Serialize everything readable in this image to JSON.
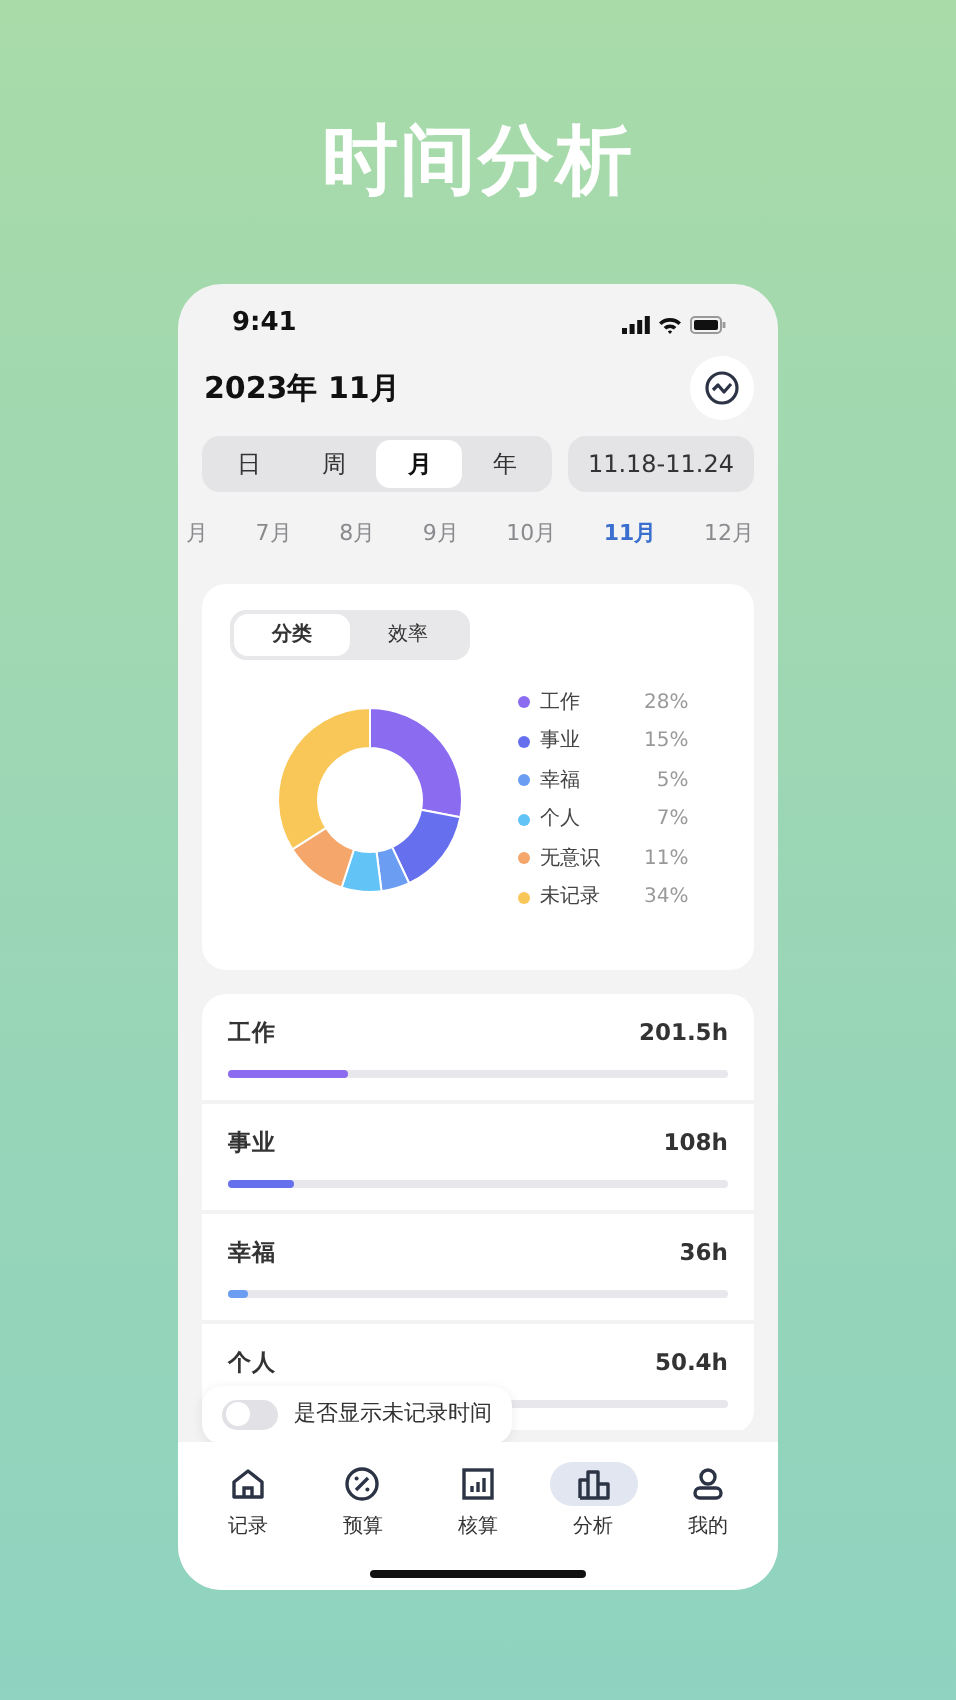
{
  "headline": "时间分析",
  "status_bar": {
    "time": "9:41"
  },
  "header": {
    "title": "2023年 11月"
  },
  "period_tabs": [
    {
      "label": "日",
      "selected": false
    },
    {
      "label": "周",
      "selected": false
    },
    {
      "label": "月",
      "selected": true
    },
    {
      "label": "年",
      "selected": false
    }
  ],
  "date_range": "11.18-11.24",
  "months": [
    {
      "label": "月",
      "selected": false
    },
    {
      "label": "7月",
      "selected": false
    },
    {
      "label": "8月",
      "selected": false
    },
    {
      "label": "9月",
      "selected": false
    },
    {
      "label": "10月",
      "selected": false
    },
    {
      "label": "11月",
      "selected": true
    },
    {
      "label": "12月",
      "selected": false
    }
  ],
  "analysis": {
    "tabs": [
      {
        "label": "分类",
        "selected": true
      },
      {
        "label": "效率",
        "selected": false
      }
    ],
    "chart_data": {
      "type": "donut",
      "categories": [
        "工作",
        "事业",
        "幸福",
        "个人",
        "无意识",
        "未记录"
      ],
      "values": [
        28,
        15,
        5,
        7,
        11,
        34
      ]
    },
    "legend": [
      {
        "percent": "28%",
        "color": "#8b6cf0"
      },
      {
        "percent": "15%",
        "color": "#6670ee"
      },
      {
        "percent": "5%",
        "color": "#6b9df2"
      },
      {
        "percent": "7%",
        "color": "#62c4f6"
      },
      {
        "percent": "11%",
        "color": "#f5a66a"
      },
      {
        "percent": "34%",
        "color": "#f8c758"
      }
    ]
  },
  "categories": [
    {
      "name": "工作",
      "hours": "201.5h",
      "level": 0.24,
      "color": "#8b6cf0"
    },
    {
      "name": "事业",
      "hours": "108h",
      "level": 0.13,
      "color": "#6670ee"
    },
    {
      "name": "幸福",
      "hours": "36h",
      "level": 0.04,
      "color": "#6b9df2"
    },
    {
      "name": "个人",
      "hours": "50.4h"
    }
  ],
  "toggle": {
    "label": "是否显示未记录时间",
    "on": false
  },
  "tab_bar": [
    {
      "label": "记录",
      "selected": false
    },
    {
      "label": "预算",
      "selected": false
    },
    {
      "label": "核算",
      "selected": false
    },
    {
      "label": "分析",
      "selected": true
    },
    {
      "label": "我的",
      "selected": false
    }
  ]
}
